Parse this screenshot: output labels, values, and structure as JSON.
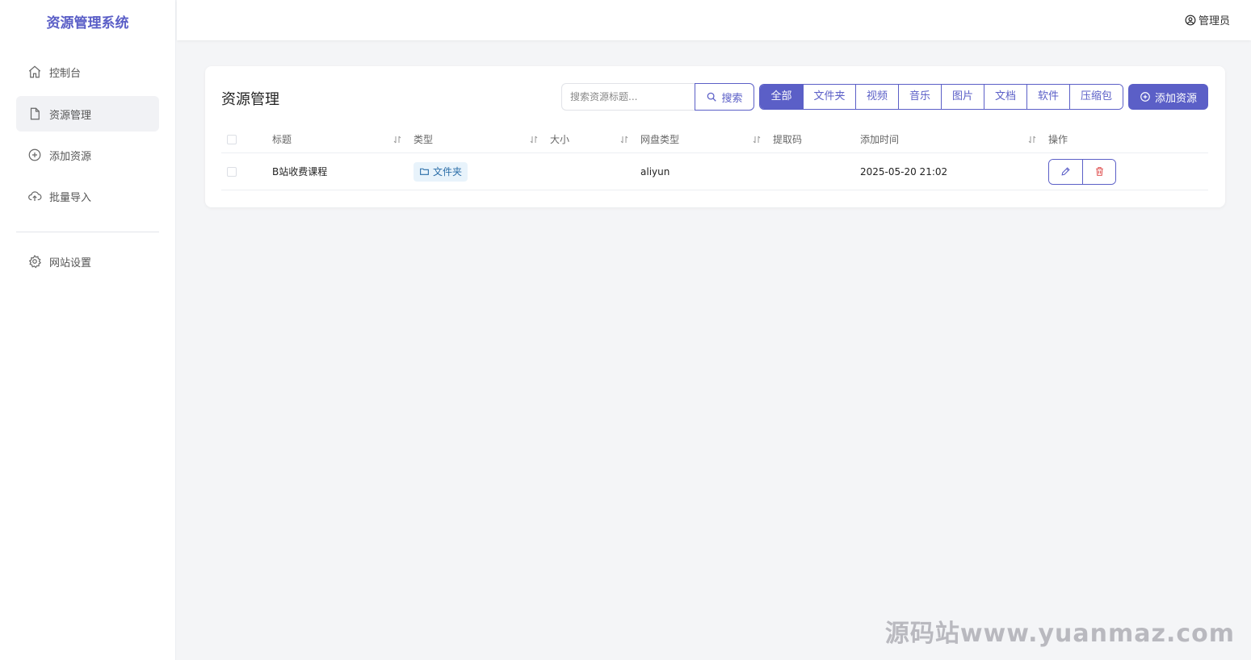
{
  "app": {
    "title": "资源管理系统"
  },
  "sidebar": {
    "items": [
      {
        "label": "控制台",
        "icon": "home-icon"
      },
      {
        "label": "资源管理",
        "icon": "file-icon",
        "active": true
      },
      {
        "label": "添加资源",
        "icon": "plus-circle-icon"
      },
      {
        "label": "批量导入",
        "icon": "cloud-upload-icon"
      },
      {
        "label": "网站设置",
        "icon": "gear-icon"
      }
    ]
  },
  "header": {
    "user_label": "管理员",
    "user_icon": "user-circle-icon"
  },
  "main": {
    "title": "资源管理",
    "search": {
      "placeholder": "搜索资源标题...",
      "button_label": "搜索"
    },
    "filters": [
      "全部",
      "文件夹",
      "视频",
      "音乐",
      "图片",
      "文档",
      "软件",
      "压缩包"
    ],
    "active_filter": "全部",
    "add_button_label": "添加资源",
    "table": {
      "columns": [
        "标题",
        "类型",
        "大小",
        "网盘类型",
        "提取码",
        "添加时间",
        "操作"
      ],
      "rows": [
        {
          "title": "B站收费课程",
          "type": "文件夹",
          "size": "",
          "disk_type": "aliyun",
          "code": "",
          "added_at": "2025-05-20 21:02"
        }
      ]
    }
  },
  "watermark": "源码站www.yuanmaz.com",
  "colors": {
    "accent": "#5b5fc7",
    "tag_bg": "#e8f3fb",
    "tag_text": "#2b6ea8",
    "danger": "#e05555"
  }
}
